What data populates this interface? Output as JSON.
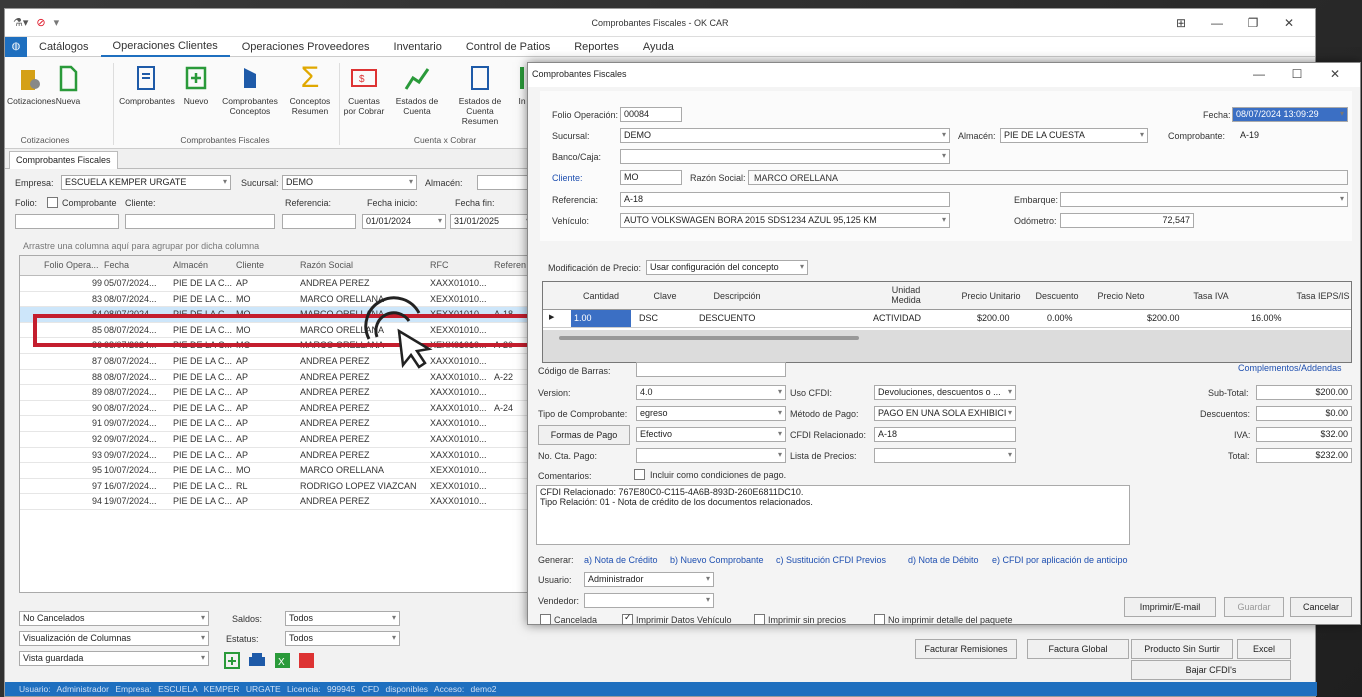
{
  "window": {
    "title": "Comprobantes Fiscales - OK CAR"
  },
  "menu": [
    "Catálogos",
    "Operaciones Clientes",
    "Operaciones Proveedores",
    "Inventario",
    "Control de Patios",
    "Reportes",
    "Ayuda"
  ],
  "ribbon": {
    "buttons": [
      "Cotizaciones",
      "Nueva",
      "Comprobantes",
      "Nuevo",
      "Comprobantes Conceptos",
      "Conceptos Resumen",
      "Cuentas por Cobrar",
      "Estados de Cuenta",
      "Estados de Cuenta Resumen",
      "In"
    ],
    "groups": [
      "Cotizaciones",
      "Comprobantes Fiscales",
      "Cuenta x Cobrar"
    ]
  },
  "tab": "Comprobantes Fiscales",
  "filters": {
    "empresa_label": "Empresa:",
    "empresa": "ESCUELA KEMPER URGATE",
    "sucursal_label": "Sucursal:",
    "sucursal": "DEMO",
    "almacen_label": "Almacén:",
    "folio_label": "Folio:",
    "comprobante_label": "Comprobante",
    "cliente_label": "Cliente:",
    "referencia_label": "Referencia:",
    "fecha_inicio_label": "Fecha inicio:",
    "fecha_inicio": "01/01/2024",
    "fecha_fin_label": "Fecha fin:",
    "fecha_fin": "31/01/2025"
  },
  "group_hint": "Arrastre una columna aquí para agrupar por dicha columna",
  "grid": {
    "columns": [
      "Folio Opera...",
      "Fecha",
      "Almacén",
      "Cliente",
      "Razón Social",
      "RFC",
      "Referen"
    ],
    "rows": [
      [
        "99",
        "05/07/2024...",
        "PIE DE LA C...",
        "AP",
        "ANDREA PEREZ",
        "XAXX01010...",
        ""
      ],
      [
        "83",
        "08/07/2024...",
        "PIE DE LA C...",
        "MO",
        "MARCO ORELLANA",
        "XEXX01010...",
        ""
      ],
      [
        "84",
        "08/07/2024...",
        "PIE DE LA C...",
        "MO",
        "MARCO ORELLANA",
        "XEXX01010...",
        "A-18"
      ],
      [
        "85",
        "08/07/2024...",
        "PIE DE LA C...",
        "MO",
        "MARCO ORELLANA",
        "XEXX01010...",
        ""
      ],
      [
        "86",
        "08/07/2024...",
        "PIE DE LA C...",
        "MO",
        "MARCO ORELLANA",
        "XEXX01010...",
        "A-20"
      ],
      [
        "87",
        "08/07/2024...",
        "PIE DE LA C...",
        "AP",
        "ANDREA PEREZ",
        "XAXX01010...",
        ""
      ],
      [
        "88",
        "08/07/2024...",
        "PIE DE LA C...",
        "AP",
        "ANDREA PEREZ",
        "XAXX01010...",
        "A-22"
      ],
      [
        "89",
        "08/07/2024...",
        "PIE DE LA C...",
        "AP",
        "ANDREA PEREZ",
        "XAXX01010...",
        ""
      ],
      [
        "90",
        "08/07/2024...",
        "PIE DE LA C...",
        "AP",
        "ANDREA PEREZ",
        "XAXX01010...",
        "A-24"
      ],
      [
        "91",
        "09/07/2024...",
        "PIE DE LA C...",
        "AP",
        "ANDREA PEREZ",
        "XAXX01010...",
        ""
      ],
      [
        "92",
        "09/07/2024...",
        "PIE DE LA C...",
        "AP",
        "ANDREA PEREZ",
        "XAXX01010...",
        ""
      ],
      [
        "93",
        "09/07/2024...",
        "PIE DE LA C...",
        "AP",
        "ANDREA PEREZ",
        "XAXX01010...",
        ""
      ],
      [
        "95",
        "10/07/2024...",
        "PIE DE LA C...",
        "MO",
        "MARCO ORELLANA",
        "XEXX01010...",
        ""
      ],
      [
        "97",
        "16/07/2024...",
        "PIE DE LA C...",
        "RL",
        "RODRIGO LOPEZ VIAZCAN",
        "XEXX01010...",
        ""
      ],
      [
        "94",
        "19/07/2024...",
        "PIE DE LA C...",
        "AP",
        "ANDREA PEREZ",
        "XAXX01010...",
        ""
      ]
    ]
  },
  "bottom_filters": {
    "cancelados": "No Cancelados",
    "columnas": "Visualización de Columnas",
    "vista": "Vista guardada",
    "saldos_label": "Saldos:",
    "saldos": "Todos",
    "estatus_label": "Estatus:",
    "estatus": "Todos"
  },
  "statusbar": "Usuario: Administrador   Empresa: ESCUELA KEMPER URGATE   Licencia: 999945 CFD disponibles   Acceso: demo2",
  "dialog": {
    "title": "Comprobantes Fiscales",
    "folio_label": "Folio Operación:",
    "folio": "00084",
    "fecha_label": "Fecha:",
    "fecha": "08/07/2024 13:09:29",
    "sucursal_label": "Sucursal:",
    "sucursal": "DEMO",
    "almacen_label": "Almacén:",
    "almacen": "PIE DE LA CUESTA",
    "comprobante_label": "Comprobante:",
    "comprobante": "A-19",
    "banco_label": "Banco/Caja:",
    "cliente_label": "Cliente:",
    "cliente": "MO",
    "razon_label": "Razón Social:",
    "razon": "MARCO ORELLANA",
    "referencia_label": "Referencia:",
    "referencia": "A-18",
    "embarque_label": "Embarque:",
    "vehiculo_label": "Vehículo:",
    "vehiculo": "AUTO VOLKSWAGEN BORA 2015 SDS1234 AZUL  95,125 KM",
    "odometro_label": "Odómetro:",
    "odometro": "72,547",
    "modif_label": "Modificación de Precio:",
    "modif": "Usar configuración del concepto",
    "grid_cols": [
      "Cantidad",
      "Clave",
      "Descripción",
      "Unidad Medida",
      "Precio Unitario",
      "Descuento",
      "Precio Neto",
      "Tasa IVA",
      "Tasa IEPS/IS"
    ],
    "grid_row": [
      "1.00",
      "DSC",
      "DESCUENTO",
      "ACTIVIDAD",
      "$200.00",
      "0.00%",
      "$200.00",
      "16.00%"
    ],
    "barcode_label": "Código de Barras:",
    "complementos": "Complementos/Addendas",
    "version_label": "Version:",
    "version": "4.0",
    "uso_label": "Uso CFDI:",
    "uso": "Devoluciones, descuentos o ...",
    "tipo_label": "Tipo de Comprobante:",
    "tipo": "egreso",
    "metodo_label": "Método de Pago:",
    "metodo": "PAGO EN UNA SOLA EXHIBICI",
    "formas_btn": "Formas de Pago",
    "formas": "Efectivo",
    "cfdi_rel_label": "CFDI Relacionado:",
    "cfdi_rel": "A-18",
    "cta_label": "No. Cta. Pago:",
    "lista_label": "Lista de Precios:",
    "comentarios_label": "Comentarios:",
    "incluir": "Incluir como condiciones de pago.",
    "comentarios_1": "CFDI Relacionado: 767E80C0-C115-4A6B-893D-260E6811DC10.",
    "comentarios_2": "Tipo Relación: 01 - Nota de crédito de los documentos relacionados.",
    "subtotal_label": "Sub-Total:",
    "subtotal": "$200.00",
    "descuentos_label": "Descuentos:",
    "descuentos": "$0.00",
    "iva_label": "IVA:",
    "iva": "$32.00",
    "total_label": "Total:",
    "total": "$232.00",
    "generar_label": "Generar:",
    "generar_links": [
      "a) Nota de Crédito",
      "b) Nuevo Comprobante",
      "c) Sustitución CFDI Previos",
      "d) Nota de Débito",
      "e) CFDI por aplicación de anticipo"
    ],
    "usuario_label": "Usuario:",
    "usuario": "Administrador",
    "vendedor_label": "Vendedor:",
    "checks": [
      "Cancelada",
      "Imprimir Datos Vehículo",
      "Imprimir sin precios",
      "No imprimir detalle del paquete"
    ],
    "imprimir": "Imprimir/E-mail",
    "guardar": "Guardar",
    "cancelar": "Cancelar"
  },
  "footer_buttons": [
    "Facturar Remisiones",
    "Factura Global",
    "Producto Sin Surtir",
    "Excel",
    "Bajar CFDI's"
  ]
}
